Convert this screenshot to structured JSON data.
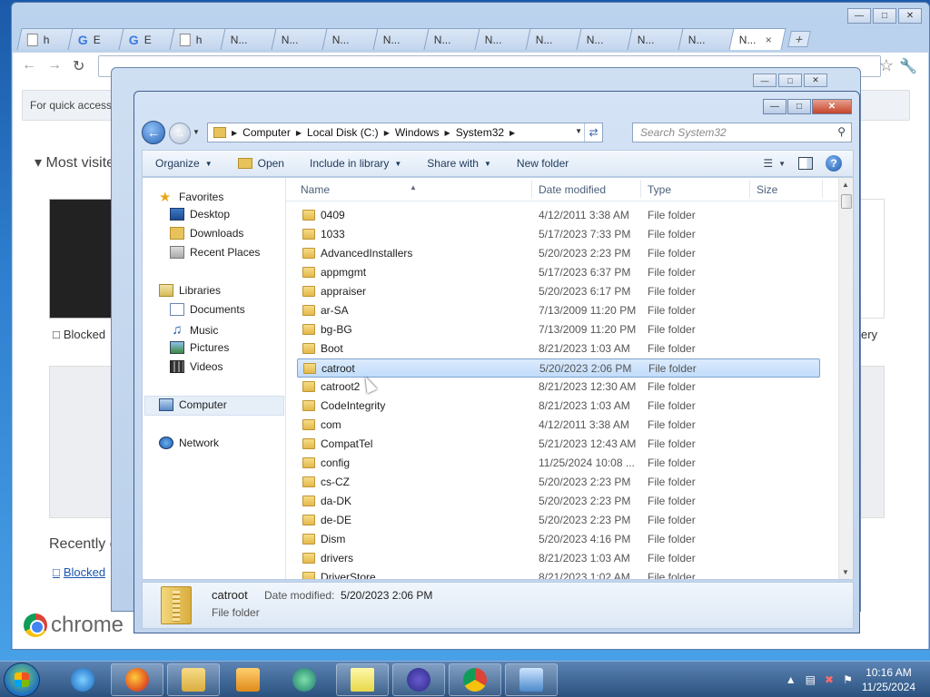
{
  "chrome": {
    "tabs": [
      {
        "label": "h",
        "icon": "page-icon"
      },
      {
        "label": "E",
        "icon": "google-icon"
      },
      {
        "label": "E",
        "icon": "google-icon"
      },
      {
        "label": "h",
        "icon": "page-icon"
      },
      {
        "label": "N...",
        "icon": "none"
      },
      {
        "label": "N...",
        "icon": "none"
      },
      {
        "label": "N...",
        "icon": "none"
      },
      {
        "label": "N...",
        "icon": "none"
      },
      {
        "label": "N...",
        "icon": "none"
      },
      {
        "label": "N...",
        "icon": "none"
      },
      {
        "label": "N...",
        "icon": "none"
      },
      {
        "label": "N...",
        "icon": "none"
      },
      {
        "label": "N...",
        "icon": "none"
      },
      {
        "label": "N...",
        "icon": "none"
      },
      {
        "label": "N...",
        "icon": "none",
        "active": true
      }
    ],
    "ntp": {
      "apps_bar_text": "For quick access,",
      "most_visited": "Most visite",
      "thumb_caption": "Blocked",
      "right_caption": "ery",
      "recently_closed": "Recently c",
      "recent_link": "Blocked",
      "logo_text": "chrome"
    }
  },
  "explorer": {
    "breadcrumb": [
      "Computer",
      "Local Disk (C:)",
      "Windows",
      "System32"
    ],
    "search_placeholder": "Search System32",
    "commands": {
      "organize": "Organize",
      "open": "Open",
      "include": "Include in library",
      "share": "Share with",
      "new_folder": "New folder"
    },
    "nav": {
      "favorites": "Favorites",
      "desktop": "Desktop",
      "downloads": "Downloads",
      "recent": "Recent Places",
      "libraries": "Libraries",
      "documents": "Documents",
      "music": "Music",
      "pictures": "Pictures",
      "videos": "Videos",
      "computer": "Computer",
      "network": "Network"
    },
    "columns": {
      "name": "Name",
      "date": "Date modified",
      "type": "Type",
      "size": "Size"
    },
    "files": [
      {
        "name": "0409",
        "date": "4/12/2011 3:38 AM",
        "type": "File folder"
      },
      {
        "name": "1033",
        "date": "5/17/2023 7:33 PM",
        "type": "File folder"
      },
      {
        "name": "AdvancedInstallers",
        "date": "5/20/2023 2:23 PM",
        "type": "File folder"
      },
      {
        "name": "appmgmt",
        "date": "5/17/2023 6:37 PM",
        "type": "File folder"
      },
      {
        "name": "appraiser",
        "date": "5/20/2023 6:17 PM",
        "type": "File folder"
      },
      {
        "name": "ar-SA",
        "date": "7/13/2009 11:20 PM",
        "type": "File folder"
      },
      {
        "name": "bg-BG",
        "date": "7/13/2009 11:20 PM",
        "type": "File folder"
      },
      {
        "name": "Boot",
        "date": "8/21/2023 1:03 AM",
        "type": "File folder"
      },
      {
        "name": "catroot",
        "date": "5/20/2023 2:06 PM",
        "type": "File folder",
        "selected": true
      },
      {
        "name": "catroot2",
        "date": "8/21/2023 12:30 AM",
        "type": "File folder"
      },
      {
        "name": "CodeIntegrity",
        "date": "8/21/2023 1:03 AM",
        "type": "File folder"
      },
      {
        "name": "com",
        "date": "4/12/2011 3:38 AM",
        "type": "File folder"
      },
      {
        "name": "CompatTel",
        "date": "5/21/2023 12:43 AM",
        "type": "File folder"
      },
      {
        "name": "config",
        "date": "11/25/2024 10:08 ...",
        "type": "File folder"
      },
      {
        "name": "cs-CZ",
        "date": "5/20/2023 2:23 PM",
        "type": "File folder"
      },
      {
        "name": "da-DK",
        "date": "5/20/2023 2:23 PM",
        "type": "File folder"
      },
      {
        "name": "de-DE",
        "date": "5/20/2023 2:23 PM",
        "type": "File folder"
      },
      {
        "name": "Dism",
        "date": "5/20/2023 4:16 PM",
        "type": "File folder"
      },
      {
        "name": "drivers",
        "date": "8/21/2023 1:03 AM",
        "type": "File folder"
      },
      {
        "name": "DriverStore",
        "date": "8/21/2023 1:02 AM",
        "type": "File folder"
      }
    ],
    "details": {
      "name": "catroot",
      "date_label": "Date modified:",
      "date_value": "5/20/2023 2:06 PM",
      "type": "File folder"
    }
  },
  "taskbar": {
    "time": "10:16 AM",
    "date": "11/25/2024",
    "pinned": [
      "ie-icon",
      "firefox-icon",
      "explorer-icon",
      "media-player-icon",
      "app-icon",
      "sticky-notes-icon",
      "visual-studio-icon",
      "chrome-icon",
      "control-panel-icon"
    ]
  }
}
